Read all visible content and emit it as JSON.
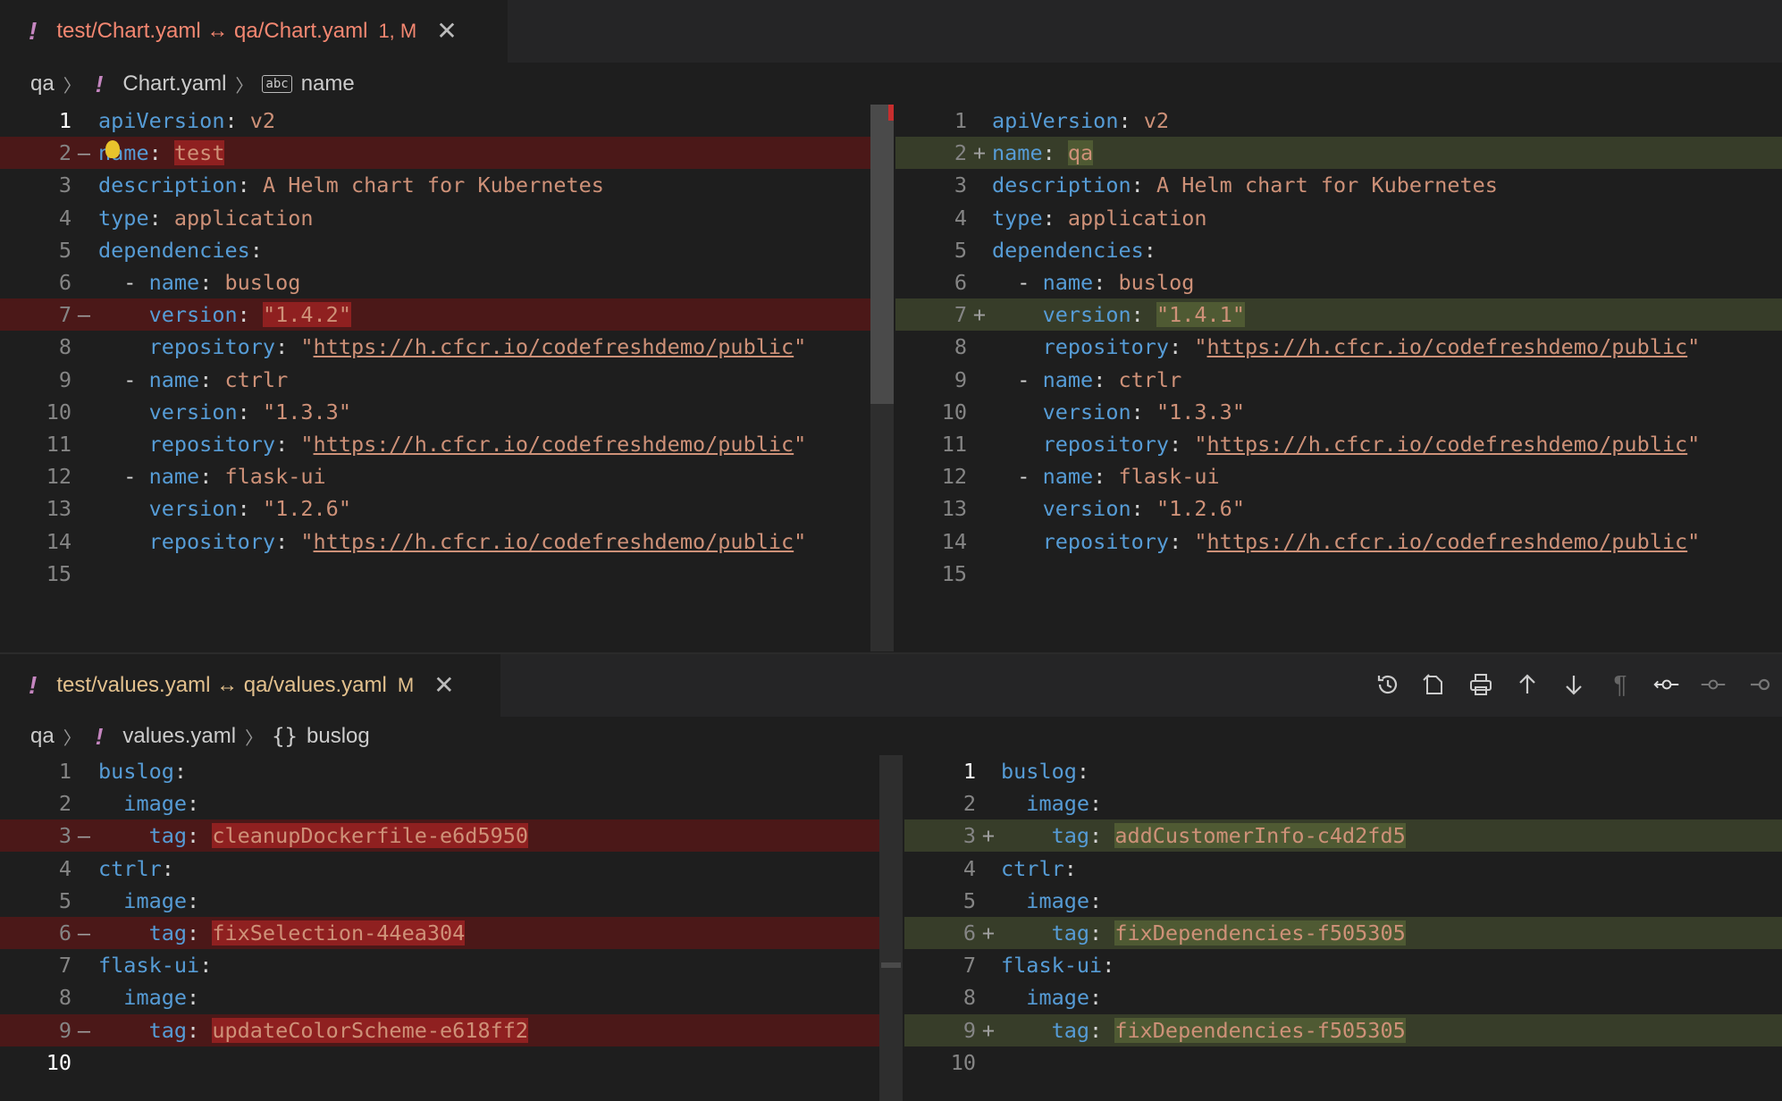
{
  "top_editor": {
    "tab": {
      "title": "test/Chart.yaml ↔ qa/Chart.yaml",
      "badge": "1, M"
    },
    "breadcrumb": {
      "folder": "qa",
      "file": "Chart.yaml",
      "symbol": "name"
    },
    "left": [
      {
        "n": "1",
        "mark": "",
        "type": "ctx",
        "text": "apiVersion: v2"
      },
      {
        "n": "2",
        "mark": "—",
        "type": "del",
        "text": "name: test"
      },
      {
        "n": "3",
        "mark": "",
        "type": "ctx",
        "text": "description: A Helm chart for Kubernetes"
      },
      {
        "n": "4",
        "mark": "",
        "type": "ctx",
        "text": "type: application"
      },
      {
        "n": "5",
        "mark": "",
        "type": "ctx",
        "text": "dependencies:"
      },
      {
        "n": "6",
        "mark": "",
        "type": "ctx",
        "text": "  - name: buslog"
      },
      {
        "n": "7",
        "mark": "—",
        "type": "del",
        "text": "    version: \"1.4.2\""
      },
      {
        "n": "8",
        "mark": "",
        "type": "ctx",
        "text": "    repository: \"https://h.cfcr.io/codefreshdemo/public\""
      },
      {
        "n": "9",
        "mark": "",
        "type": "ctx",
        "text": "  - name: ctrlr"
      },
      {
        "n": "10",
        "mark": "",
        "type": "ctx",
        "text": "    version: \"1.3.3\""
      },
      {
        "n": "11",
        "mark": "",
        "type": "ctx",
        "text": "    repository: \"https://h.cfcr.io/codefreshdemo/public\""
      },
      {
        "n": "12",
        "mark": "",
        "type": "ctx",
        "text": "  - name: flask-ui"
      },
      {
        "n": "13",
        "mark": "",
        "type": "ctx",
        "text": "    version: \"1.2.6\""
      },
      {
        "n": "14",
        "mark": "",
        "type": "ctx",
        "text": "    repository: \"https://h.cfcr.io/codefreshdemo/public\""
      },
      {
        "n": "15",
        "mark": "",
        "type": "ctx",
        "text": ""
      }
    ],
    "right": [
      {
        "n": "1",
        "mark": "",
        "type": "ctx",
        "text": "apiVersion: v2"
      },
      {
        "n": "2",
        "mark": "+",
        "type": "ins",
        "text": "name: qa"
      },
      {
        "n": "3",
        "mark": "",
        "type": "ctx",
        "text": "description: A Helm chart for Kubernetes"
      },
      {
        "n": "4",
        "mark": "",
        "type": "ctx",
        "text": "type: application"
      },
      {
        "n": "5",
        "mark": "",
        "type": "ctx",
        "text": "dependencies:"
      },
      {
        "n": "6",
        "mark": "",
        "type": "ctx",
        "text": "  - name: buslog"
      },
      {
        "n": "7",
        "mark": "+",
        "type": "ins",
        "text": "    version: \"1.4.1\""
      },
      {
        "n": "8",
        "mark": "",
        "type": "ctx",
        "text": "    repository: \"https://h.cfcr.io/codefreshdemo/public\""
      },
      {
        "n": "9",
        "mark": "",
        "type": "ctx",
        "text": "  - name: ctrlr"
      },
      {
        "n": "10",
        "mark": "",
        "type": "ctx",
        "text": "    version: \"1.3.3\""
      },
      {
        "n": "11",
        "mark": "",
        "type": "ctx",
        "text": "    repository: \"https://h.cfcr.io/codefreshdemo/public\""
      },
      {
        "n": "12",
        "mark": "",
        "type": "ctx",
        "text": "  - name: flask-ui"
      },
      {
        "n": "13",
        "mark": "",
        "type": "ctx",
        "text": "    version: \"1.2.6\""
      },
      {
        "n": "14",
        "mark": "",
        "type": "ctx",
        "text": "    repository: \"https://h.cfcr.io/codefreshdemo/public\""
      },
      {
        "n": "15",
        "mark": "",
        "type": "ctx",
        "text": ""
      }
    ]
  },
  "bottom_editor": {
    "tab": {
      "title": "test/values.yaml ↔ qa/values.yaml",
      "badge": "M"
    },
    "breadcrumb": {
      "folder": "qa",
      "file": "values.yaml",
      "symbol": "buslog"
    },
    "toolbar": [
      "history-icon",
      "open-file-icon",
      "print-icon",
      "arrow-up-icon",
      "arrow-down-icon",
      "pilcrow-icon",
      "git-compare-icon",
      "git-commit-icon",
      "git-commit-icon"
    ],
    "left": [
      {
        "n": "1",
        "mark": "",
        "type": "ctx",
        "text": "buslog:"
      },
      {
        "n": "2",
        "mark": "",
        "type": "ctx",
        "text": "  image:"
      },
      {
        "n": "3",
        "mark": "—",
        "type": "del",
        "text": "    tag: cleanupDockerfile-e6d5950"
      },
      {
        "n": "4",
        "mark": "",
        "type": "ctx",
        "text": "ctrlr:"
      },
      {
        "n": "5",
        "mark": "",
        "type": "ctx",
        "text": "  image:"
      },
      {
        "n": "6",
        "mark": "—",
        "type": "del",
        "text": "    tag: fixSelection-44ea304"
      },
      {
        "n": "7",
        "mark": "",
        "type": "ctx",
        "text": "flask-ui:"
      },
      {
        "n": "8",
        "mark": "",
        "type": "ctx",
        "text": "  image:"
      },
      {
        "n": "9",
        "mark": "—",
        "type": "del",
        "text": "    tag: updateColorScheme-e618ff2"
      },
      {
        "n": "10",
        "mark": "",
        "type": "ctx",
        "text": ""
      }
    ],
    "right": [
      {
        "n": "1",
        "mark": "",
        "type": "ctx",
        "text": "buslog:"
      },
      {
        "n": "2",
        "mark": "",
        "type": "ctx",
        "text": "  image:"
      },
      {
        "n": "3",
        "mark": "+",
        "type": "ins",
        "text": "    tag: addCustomerInfo-c4d2fd5"
      },
      {
        "n": "4",
        "mark": "",
        "type": "ctx",
        "text": "ctrlr:"
      },
      {
        "n": "5",
        "mark": "",
        "type": "ctx",
        "text": "  image:"
      },
      {
        "n": "6",
        "mark": "+",
        "type": "ins",
        "text": "    tag: fixDependencies-f505305"
      },
      {
        "n": "7",
        "mark": "",
        "type": "ctx",
        "text": "flask-ui:"
      },
      {
        "n": "8",
        "mark": "",
        "type": "ctx",
        "text": "  image:"
      },
      {
        "n": "9",
        "mark": "+",
        "type": "ins",
        "text": "    tag: fixDependencies-f505305"
      },
      {
        "n": "10",
        "mark": "",
        "type": "ctx",
        "text": ""
      }
    ]
  }
}
